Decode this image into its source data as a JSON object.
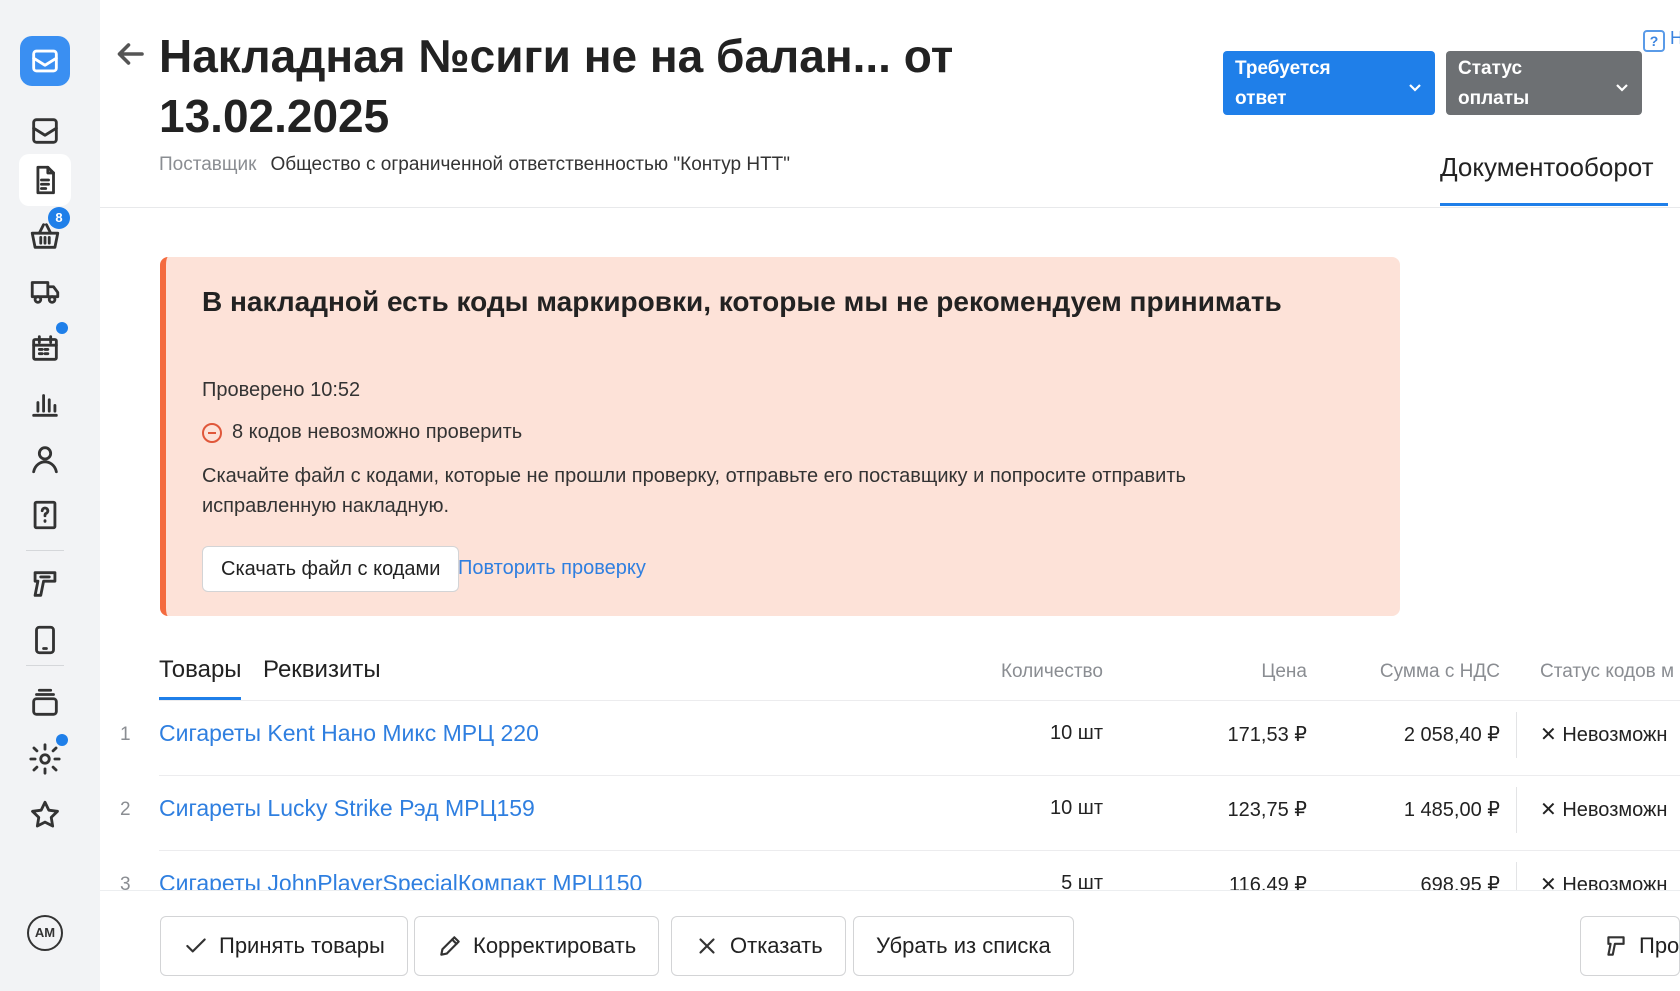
{
  "sidebar": {
    "cart_badge": "8"
  },
  "header": {
    "title": "Накладная №сиги не на балан... от 13.02.2025",
    "supplier_label": "Поставщик",
    "supplier_value": "Общество с ограниченной ответственностью \"Контур НТТ\"",
    "status_response": "Требуется ответ",
    "status_payment": "Статус оплаты",
    "help_label": "Н",
    "doc_tab": "Документооборот"
  },
  "alert": {
    "title": "В накладной есть коды маркировки, которые мы не рекомендуем принимать",
    "checked": "Проверено 10:52",
    "warning": "8 кодов невозможно проверить",
    "description": "Скачайте файл с кодами, которые не прошли проверку, отправьте его поставщику и попросите отправить исправленную накладную.",
    "download_button": "Скачать файл с кодами",
    "retry_link": "Повторить проверку"
  },
  "tabs": {
    "goods": "Товары",
    "details": "Реквизиты"
  },
  "table": {
    "columns": {
      "quantity": "Количество",
      "price": "Цена",
      "sum": "Сумма с НДС",
      "status": "Статус кодов м"
    },
    "rows": [
      {
        "num": "1",
        "name": "Сигареты Kent Нано Микс МРЦ 220",
        "qty": "10 шт",
        "price": "171,53 ₽",
        "sum": "2 058,40 ₽",
        "status": "Невозможн"
      },
      {
        "num": "2",
        "name": "Сигареты Lucky Strike Рэд МРЦ159",
        "qty": "10 шт",
        "price": "123,75 ₽",
        "sum": "1 485,00 ₽",
        "status": "Невозможн"
      },
      {
        "num": "3",
        "name": "Сигареты JohnPlayerSpecialКомпакт МРЦ150",
        "qty": "5 шт",
        "price": "116,49 ₽",
        "sum": "698,95 ₽",
        "status": "Невозможн"
      }
    ]
  },
  "footer": {
    "accept": "Принять товары",
    "correct": "Корректировать",
    "reject": "Отказать",
    "remove": "Убрать из списка",
    "more": "Про"
  }
}
